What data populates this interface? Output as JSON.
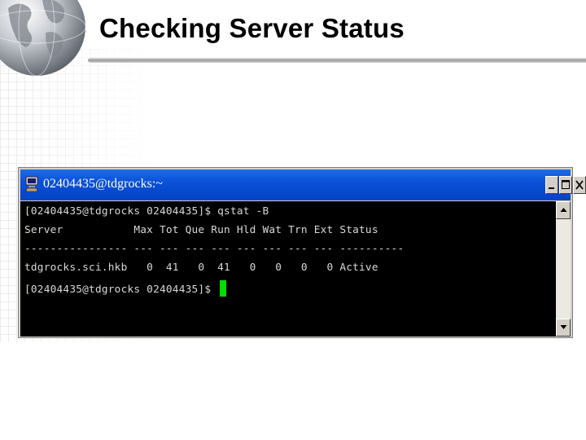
{
  "slide": {
    "title": "Checking Server Status"
  },
  "window": {
    "title": "02404435@tdgrocks:~",
    "controls": {
      "minimize_icon": "minimize-icon",
      "maximize_icon": "maximize-icon",
      "close_icon": "close-icon"
    }
  },
  "terminal": {
    "lines": [
      "[02404435@tdgrocks 02404435]$ qstat -B",
      "Server           Max Tot Que Run Hld Wat Trn Ext Status",
      "---------------- --- --- --- --- --- --- --- --- ----------",
      "tdgrocks.sci.hkb   0  41   0  41   0   0   0   0 Active",
      "[02404435@tdgrocks 02404435]$ "
    ],
    "cursor_color": "#00dd00",
    "background": "#000000",
    "foreground": "#d8d8d8"
  },
  "colors": {
    "titlebar": "#0a50d8",
    "window_frame": "#d4d0c8"
  }
}
